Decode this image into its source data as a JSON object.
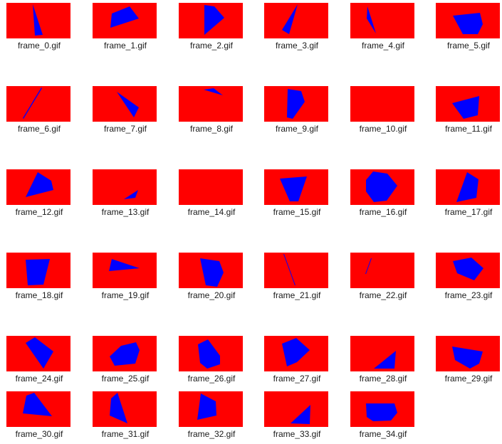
{
  "colors": {
    "thumbnail_background": "#ff0000",
    "shape_fill": "#0000ff",
    "window_background": "#ffffff",
    "label_text": "#1a1a1a"
  },
  "files": [
    {
      "name": "frame_0.gif"
    },
    {
      "name": "frame_1.gif"
    },
    {
      "name": "frame_2.gif"
    },
    {
      "name": "frame_3.gif"
    },
    {
      "name": "frame_4.gif"
    },
    {
      "name": "frame_5.gif"
    },
    {
      "name": "frame_6.gif"
    },
    {
      "name": "frame_7.gif"
    },
    {
      "name": "frame_8.gif"
    },
    {
      "name": "frame_9.gif"
    },
    {
      "name": "frame_10.gif"
    },
    {
      "name": "frame_11.gif"
    },
    {
      "name": "frame_12.gif"
    },
    {
      "name": "frame_13.gif"
    },
    {
      "name": "frame_14.gif"
    },
    {
      "name": "frame_15.gif"
    },
    {
      "name": "frame_16.gif"
    },
    {
      "name": "frame_17.gif"
    },
    {
      "name": "frame_18.gif"
    },
    {
      "name": "frame_19.gif"
    },
    {
      "name": "frame_20.gif"
    },
    {
      "name": "frame_21.gif"
    },
    {
      "name": "frame_22.gif"
    },
    {
      "name": "frame_23.gif"
    },
    {
      "name": "frame_24.gif"
    },
    {
      "name": "frame_25.gif"
    },
    {
      "name": "frame_26.gif"
    },
    {
      "name": "frame_27.gif"
    },
    {
      "name": "frame_28.gif"
    },
    {
      "name": "frame_29.gif"
    },
    {
      "name": "frame_30.gif"
    },
    {
      "name": "frame_31.gif"
    },
    {
      "name": "frame_32.gif"
    },
    {
      "name": "frame_33.gif"
    },
    {
      "name": "frame_34.gif"
    }
  ]
}
